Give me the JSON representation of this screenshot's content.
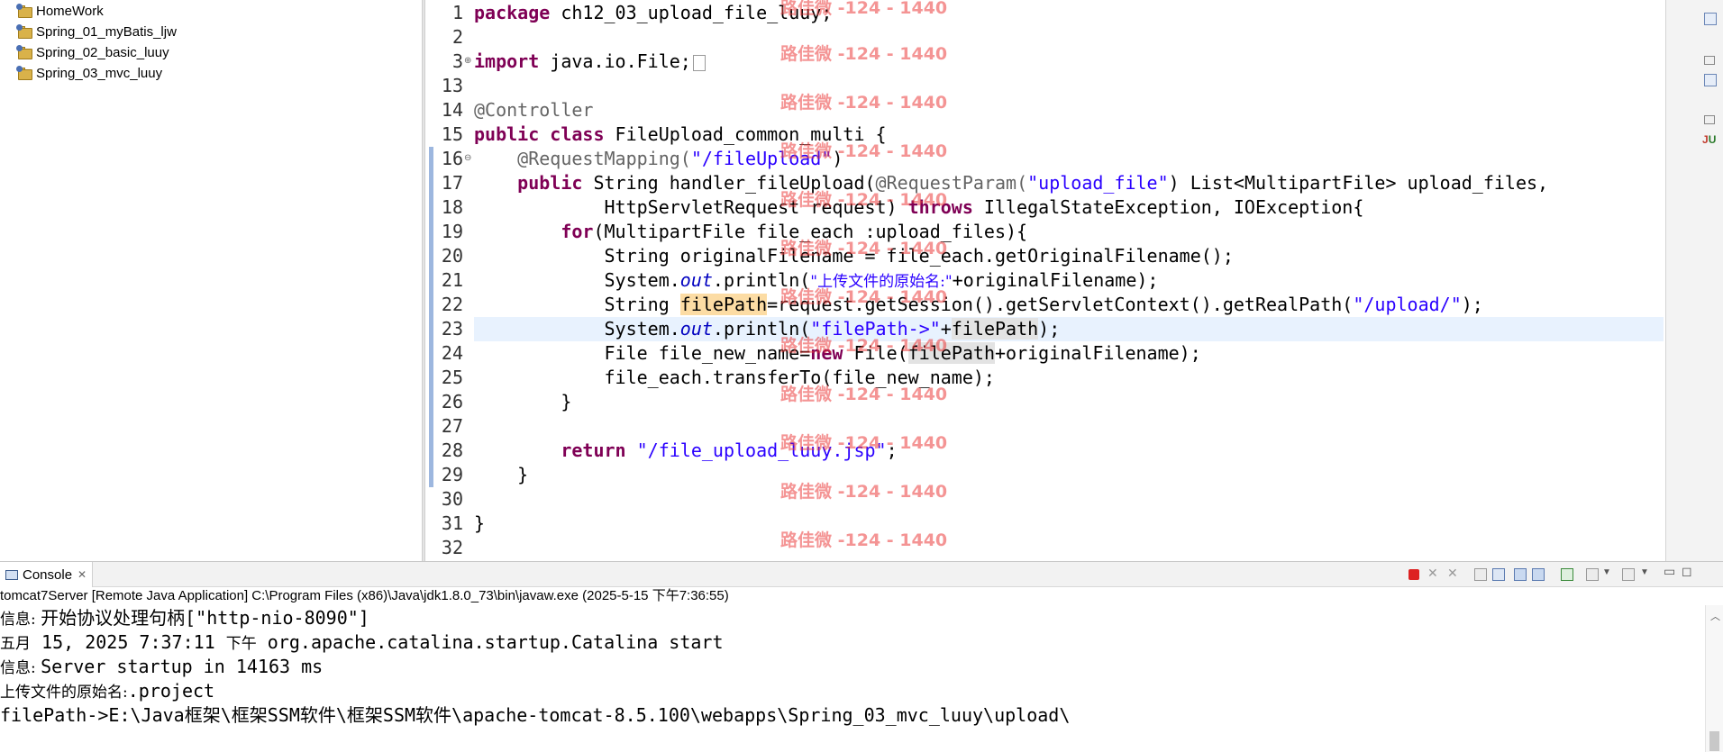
{
  "explorer": {
    "projects": [
      "HomeWork",
      "Spring_01_myBatis_ljw",
      "Spring_02_basic_luuy",
      "Spring_03_mvc_luuy"
    ]
  },
  "editor": {
    "line_numbers": [
      "1",
      "2",
      "3",
      "13",
      "14",
      "15",
      "16",
      "17",
      "18",
      "19",
      "20",
      "21",
      "22",
      "23",
      "24",
      "25",
      "26",
      "27",
      "28",
      "29",
      "30",
      "31",
      "32"
    ],
    "code": {
      "l1_kw": "package",
      "l1_rest": " ch12_03_upload_file_luuy;",
      "l3_kw": "import",
      "l3_rest": " java.io.File;",
      "l14": "@Controller",
      "l15_kw": "public class",
      "l15_rest": " FileUpload_common_multi {",
      "l16_ann": "    @RequestMapping(",
      "l16_str": "\"/fileUpload\"",
      "l16_end": ")",
      "l17_kw": "    public",
      "l17_a": " String handler_fileUpload(",
      "l17_ann": "@RequestParam(",
      "l17_str": "\"upload_file\"",
      "l17_b": ") List<MultipartFile> upload_files,",
      "l18_a": "            HttpServletRequest request) ",
      "l18_kw": "throws",
      "l18_b": " IllegalStateException, IOException{",
      "l19_kw": "        for",
      "l19_rest": "(MultipartFile file_each :upload_files){",
      "l20": "            String originalFilename = file_each.getOriginalFilename();",
      "l21_a": "            System.",
      "l21_out": "out",
      "l21_b": ".println(",
      "l21_str": "\"上传文件的原始名:\"",
      "l21_c": "+originalFilename);",
      "l22_a": "            String ",
      "l22_var": "filePath",
      "l22_b": "=request.getSession().getServletContext().getRealPath(",
      "l22_str": "\"/upload/\"",
      "l22_c": ");",
      "l23_a": "            System.",
      "l23_out": "out",
      "l23_b": ".println(",
      "l23_str": "\"filePath->\"",
      "l23_c": "+",
      "l23_var": "filePath",
      "l23_d": ");",
      "l24_a": "            File file_new_name=",
      "l24_kw": "new",
      "l24_b": " File(",
      "l24_var": "filePath",
      "l24_c": "+originalFilename);",
      "l25": "            file_each.transferTo(file_new_name);",
      "l26": "        }",
      "l28_kw": "        return",
      "l28_sp": " ",
      "l28_str": "\"/file_upload_luuy.jsp\"",
      "l28_end": ";",
      "l29": "    }",
      "l31": "}"
    }
  },
  "watermark": "路佳微 -124 - 1440",
  "console": {
    "tab_label": "Console",
    "close_glyph": "✕",
    "title": "tomcat7Server [Remote Java Application] C:\\Program Files (x86)\\Java\\jdk1.8.0_73\\bin\\javaw.exe (2025-5-15 下午7:36:55)",
    "lines": [
      {
        "cjk": "信息: ",
        "text": "开始协议处理句柄[\"http-nio-8090\"]"
      },
      {
        "cjk": "五月",
        "text": " 15, 2025 7:37:11 ",
        "cjk2": "下午",
        "text2": " org.apache.catalina.startup.Catalina start"
      },
      {
        "cjk": "信息: ",
        "text": "Server startup in 14163 ms"
      },
      {
        "cjk": "上传文件的原始名:",
        "text": ".project"
      },
      {
        "text": "filePath->E:\\Java框架\\框架SSM软件\\框架SSM软件\\apache-tomcat-8.5.100\\webapps\\Spring_03_mvc_luuy\\upload\\"
      }
    ]
  },
  "colors": {
    "keyword": "#7f0055",
    "string": "#2a00ff",
    "annotation": "#646464",
    "static_field": "#0000c0",
    "current_line": "#e8f2fe",
    "occurrence": "#fcdca4",
    "watermark": "#eb3c3c"
  }
}
